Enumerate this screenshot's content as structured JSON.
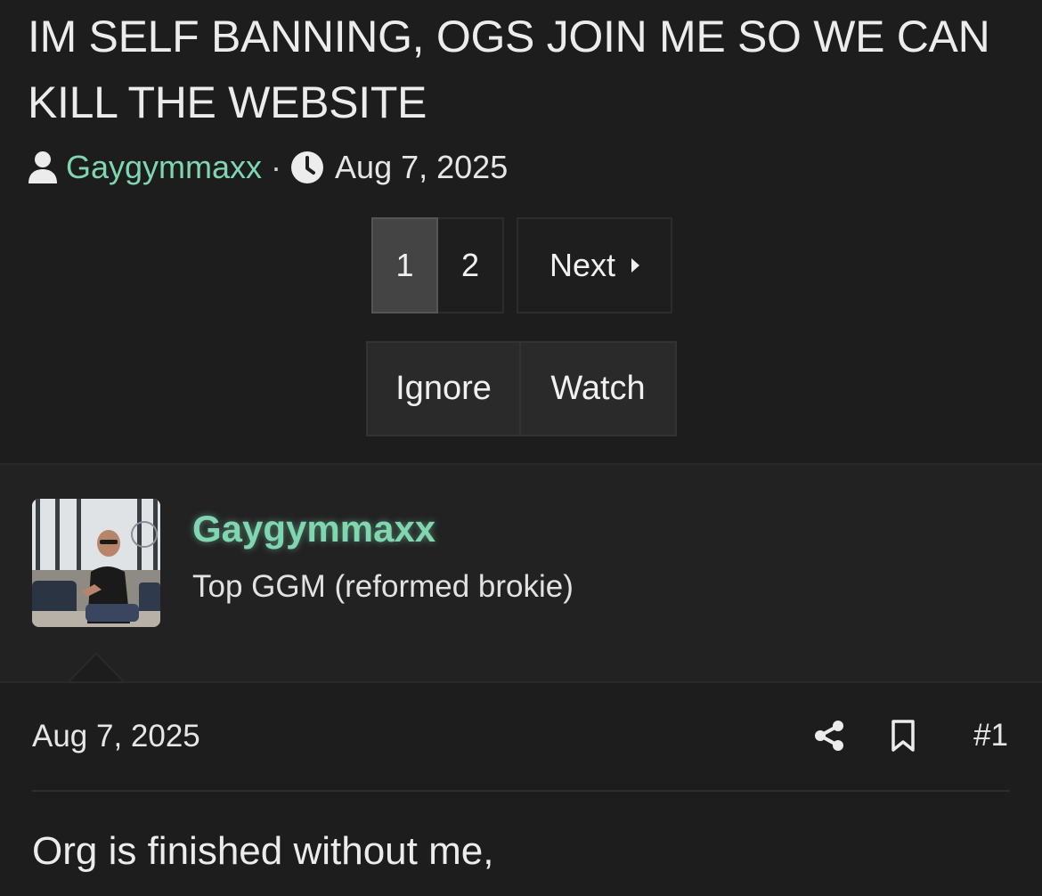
{
  "thread": {
    "title": "IM SELF BANNING, OGS JOIN ME SO WE CAN KILL THE WEBSITE",
    "author": "Gaygymmaxx",
    "separator": "·",
    "date": "Aug 7, 2025"
  },
  "pagination": {
    "current": "1",
    "page2": "2",
    "next_label": "Next"
  },
  "actions": {
    "ignore_label": "Ignore",
    "watch_label": "Watch"
  },
  "post": {
    "username": "Gaygymmaxx",
    "user_title": "Top GGM (reformed brokie)",
    "date": "Aug 7, 2025",
    "number": "#1",
    "body": "Org is finished without me,"
  },
  "icons": {
    "author": "user-icon",
    "date": "clock-icon",
    "next": "caret-right-icon",
    "share": "share-icon",
    "bookmark": "bookmark-icon"
  },
  "colors": {
    "background": "#1d1d1d",
    "username_accent": "#7fd6b1",
    "button_active": "#444444",
    "text": "#e6e6e6"
  }
}
